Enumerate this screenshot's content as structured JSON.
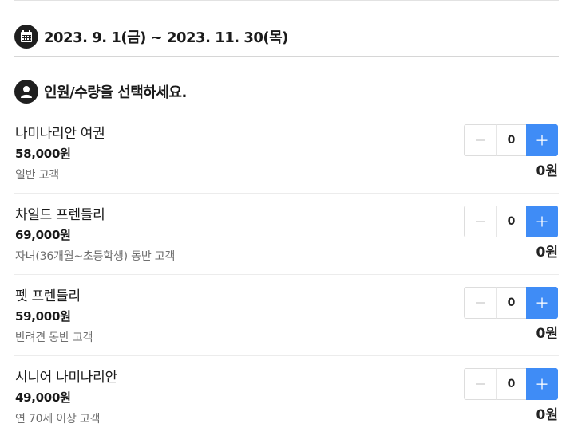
{
  "date_section": {
    "icon": "calendar-icon",
    "range_text": "2023. 9. 1(금) ~ 2023. 11. 30(목)"
  },
  "people_section": {
    "icon": "user-icon",
    "title": "인원/수량을 선택하세요."
  },
  "tickets": [
    {
      "name": "나미나리안 여권",
      "price": "58,000원",
      "description": "일반 고객",
      "quantity": "0",
      "total": "0원"
    },
    {
      "name": "차일드 프렌들리",
      "price": "69,000원",
      "description": "자녀(36개월~초등학생) 동반 고객",
      "quantity": "0",
      "total": "0원"
    },
    {
      "name": "펫 프렌들리",
      "price": "59,000원",
      "description": "반려견 동반 고객",
      "quantity": "0",
      "total": "0원"
    },
    {
      "name": "시니어 나미나리안",
      "price": "49,000원",
      "description": "연 70세 이상 고객",
      "quantity": "0",
      "total": "0원"
    }
  ],
  "colors": {
    "plus_button": "#3f8cf6",
    "header_icon_bg": "#1f1f1f"
  }
}
